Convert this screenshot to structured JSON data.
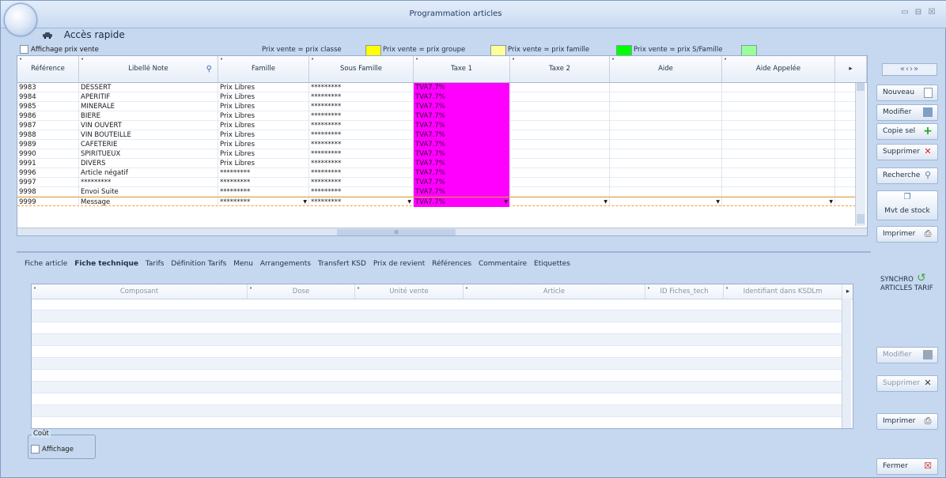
{
  "window": {
    "title": "Programmation articles",
    "minimize": "▭",
    "restore": "⊟",
    "close": "☒"
  },
  "acces_rapide": "Accès rapide",
  "affichage_prix_vente": "Affichage prix vente",
  "legend": [
    {
      "label": "Prix vente = prix classe",
      "color": "#ffff00"
    },
    {
      "label": "Prix vente = prix groupe",
      "color": "#ffff99"
    },
    {
      "label": "Prix vente = prix famille",
      "color": "#00ff00"
    },
    {
      "label": "Prix vente = prix S/Famille",
      "color": "#99ff99"
    }
  ],
  "articles": {
    "columns": [
      "Référence",
      "Libellé Note",
      "Famille",
      "Sous Famille",
      "Taxe 1",
      "Taxe 2",
      "Aide",
      "Aide Appelée"
    ],
    "rows": [
      [
        "9983",
        "DESSERT",
        "Prix Libres",
        "*********",
        "TVA7.7%"
      ],
      [
        "9984",
        "APERITIF",
        "Prix Libres",
        "*********",
        "TVA7.7%"
      ],
      [
        "9985",
        "MINERALE",
        "Prix Libres",
        "*********",
        "TVA7.7%"
      ],
      [
        "9986",
        "BIERE",
        "Prix Libres",
        "*********",
        "TVA7.7%"
      ],
      [
        "9987",
        "VIN OUVERT",
        "Prix Libres",
        "*********",
        "TVA7.7%"
      ],
      [
        "9988",
        "VIN BOUTEILLE",
        "Prix Libres",
        "*********",
        "TVA7.7%"
      ],
      [
        "9989",
        "CAFETERIE",
        "Prix Libres",
        "*********",
        "TVA7.7%"
      ],
      [
        "9990",
        "SPIRITUEUX",
        "Prix Libres",
        "*********",
        "TVA7.7%"
      ],
      [
        "9991",
        "DIVERS",
        "Prix Libres",
        "*********",
        "TVA7.7%"
      ],
      [
        "9996",
        "Article négatif",
        "*********",
        "*********",
        "TVA7.7%"
      ],
      [
        "9997",
        "*********",
        "*********",
        "*********",
        "TVA7.7%"
      ],
      [
        "9998",
        "Envoi Suite",
        "*********",
        "*********",
        "TVA7.7%"
      ],
      [
        "9999",
        "Message",
        "*********",
        "*********",
        "TVA7.7%"
      ]
    ],
    "scroll_marker": "III"
  },
  "tabs": [
    "Fiche article",
    "Fiche technique",
    "Tarifs",
    "Définition Tarifs",
    "Menu",
    "Arrangements",
    "Transfert KSD",
    "Prix de revient",
    "Références",
    "Commentaire",
    "Etiquettes"
  ],
  "fiche_technique": {
    "columns": [
      "Composant",
      "Dose",
      "Unité vente",
      "Article",
      "ID Fiches_tech",
      "Identifiant dans KSDLm"
    ]
  },
  "cout": {
    "legend": "Coût",
    "checkbox_label": "Affichage"
  },
  "nav_arrows": "«‹›»",
  "buttons": {
    "nouveau": "Nouveau",
    "modifier": "Modifier",
    "copie_sel": "Copie sel",
    "supprimer": "Supprimer",
    "recherche": "Recherche",
    "mvt_stock": "Mvt de stock",
    "imprimer": "Imprimer",
    "synchro_1": "SYNCHRO",
    "synchro_2": "ARTICLES TARIF",
    "modifier2": "Modifier",
    "supprimer2": "Supprimer",
    "imprimer2": "Imprimer",
    "fermer": "Fermer"
  }
}
